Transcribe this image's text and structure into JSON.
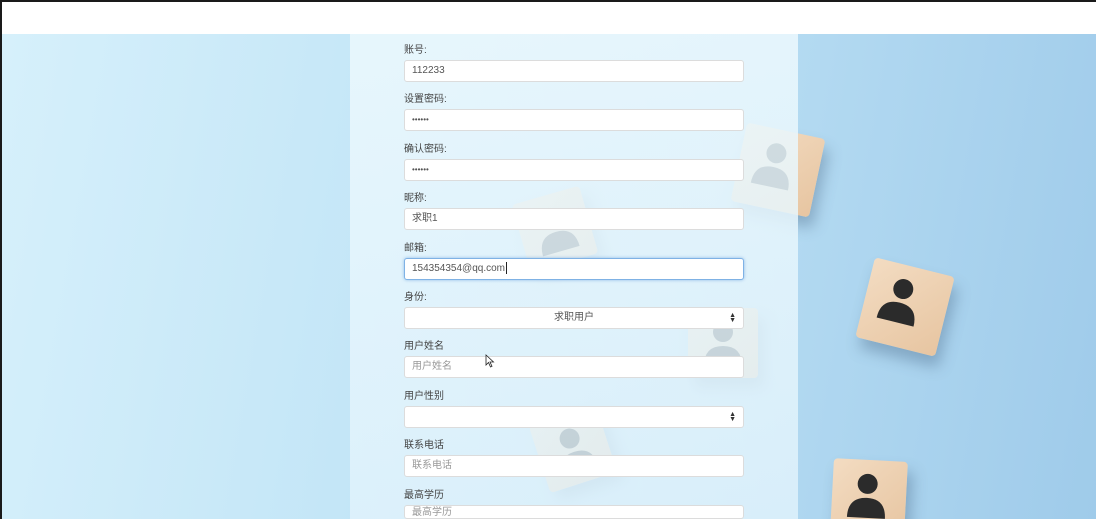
{
  "form": {
    "account": {
      "label": "账号:",
      "value": "112233"
    },
    "password": {
      "label": "设置密码:",
      "value": "••••••"
    },
    "confirm_password": {
      "label": "确认密码:",
      "value": "••••••"
    },
    "nickname": {
      "label": "昵称:",
      "value": "求职1"
    },
    "email": {
      "label": "邮箱:",
      "value": "154354354@qq.com"
    },
    "role": {
      "label": "身份:",
      "value": "求职用户"
    },
    "real_name": {
      "label": "用户姓名",
      "placeholder": "用户姓名"
    },
    "gender": {
      "label": "用户性别",
      "value": ""
    },
    "phone": {
      "label": "联系电话",
      "placeholder": "联系电话"
    },
    "education": {
      "label": "最高学历",
      "placeholder": "最高学历"
    }
  },
  "icons": {
    "select_caret": "up-down-caret-icon",
    "cursor": "mouse-pointer-icon",
    "background": "person-cube-icon"
  },
  "colors": {
    "focus_border": "#7fb2e5",
    "background": "#b2d9f1"
  }
}
